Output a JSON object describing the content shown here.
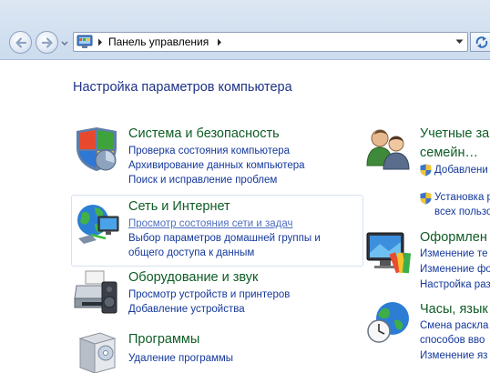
{
  "address_bar": {
    "breadcrumb": "Панель управления",
    "icon": "control-panel-icon"
  },
  "page_title": "Настройка параметров компьютера",
  "left_categories": [
    {
      "title": "Система и безопасность",
      "icon": "shield-system-icon",
      "links": [
        "Проверка состояния компьютера",
        "Архивирование данных компьютера",
        "Поиск и исправление проблем"
      ]
    },
    {
      "title": "Сеть и Интернет",
      "icon": "network-globe-icon",
      "links": [
        "Просмотр состояния сети и задач",
        "Выбор параметров домашней группы и",
        "общего доступа к данным"
      ]
    },
    {
      "title": "Оборудование и звук",
      "icon": "printer-speaker-icon",
      "links": [
        "Просмотр устройств и принтеров",
        "Добавление устройства"
      ]
    },
    {
      "title": "Программы",
      "icon": "programs-box-icon",
      "links": [
        "Удаление программы"
      ]
    }
  ],
  "right_categories": [
    {
      "title_line1": "Учетные за",
      "title_line2": "семейн…",
      "icon": "user-accounts-icon",
      "links": [
        "Добавлени",
        "Установка р",
        "всех пользо"
      ]
    },
    {
      "title": "Оформлен",
      "icon": "appearance-monitor-icon",
      "links": [
        "Изменение те",
        "Изменение фо",
        "Настройка раз"
      ]
    },
    {
      "title": "Часы, язык",
      "icon": "clock-globe-icon",
      "links": [
        "Смена раскла",
        "способов вво",
        "Изменение яз"
      ]
    }
  ],
  "colors": {
    "category_title": "#0e5c25",
    "link": "#14389c",
    "page_title": "#1e3287"
  }
}
